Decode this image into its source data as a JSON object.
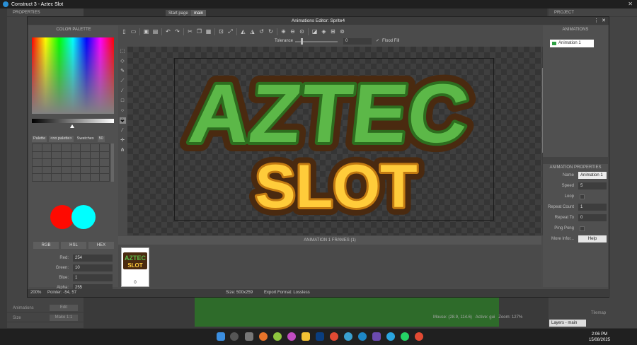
{
  "app": {
    "title": "Construct 3 - Aztec Slot"
  },
  "background": {
    "left_header": "PROPERTIES",
    "tabs": [
      "Start page",
      "main"
    ],
    "right_header": "PROJECT",
    "left_rows": [
      "Animations",
      "Size"
    ],
    "left_buttons": {
      "edit": "Edit",
      "make": "Make 1:1"
    },
    "mouse": "Mouse: (28.9, 114.6)",
    "active": "Active: gui",
    "zoom": "Zoom: 127%",
    "layers_tab": "Layers - main",
    "tilemap": "Tilemap"
  },
  "editor": {
    "title": "Animations Editor: Sprite4",
    "tolerance_label": "Tolerance",
    "tolerance_value": "0",
    "flood_fill_label": "Flood Fill"
  },
  "palette": {
    "header": "COLOR PALETTE",
    "tab_palette": "Palette",
    "palette_select": "<no palette>",
    "swatches_label": "Swatches",
    "swatches_value": "50",
    "modes": [
      "RGB",
      "HSL",
      "HEX"
    ],
    "color_rows": [
      {
        "label": "Red:",
        "value": "254"
      },
      {
        "label": "Green:",
        "value": "10"
      },
      {
        "label": "Blue:",
        "value": "1"
      },
      {
        "label": "Alpha:",
        "value": "255"
      }
    ],
    "primary_color": "#fe0a01",
    "secondary_color": "#00ffff"
  },
  "logo": {
    "line1": "AZTEC",
    "line2": "SLOT"
  },
  "frames": {
    "header": "ANIMATION 1 FRAMES (1)",
    "items": [
      {
        "number": "0",
        "thumb_line1": "AZTEC",
        "thumb_line2": "SLOT"
      }
    ]
  },
  "animations": {
    "header": "ANIMATIONS",
    "items": [
      {
        "name": "Animation 1"
      }
    ]
  },
  "properties": {
    "header": "ANIMATION PROPERTIES",
    "name": {
      "label": "Name",
      "value": "Animation 1"
    },
    "speed": {
      "label": "Speed",
      "value": "5"
    },
    "loop": {
      "label": "Loop"
    },
    "repeat_count": {
      "label": "Repeat Count",
      "value": "1"
    },
    "repeat_to": {
      "label": "Repeat To",
      "value": "0"
    },
    "ping_pong": {
      "label": "Ping Pong"
    },
    "more_info": {
      "label": "More Infor...",
      "button": "Help"
    }
  },
  "status": {
    "zoom": "200%",
    "pointer": "Pointer: -54, 57",
    "size": "Size: 500x259",
    "export_format": "Export Format: Lossless"
  },
  "taskbar": {
    "time": "2:06 PM",
    "date": "15/08/2025"
  }
}
